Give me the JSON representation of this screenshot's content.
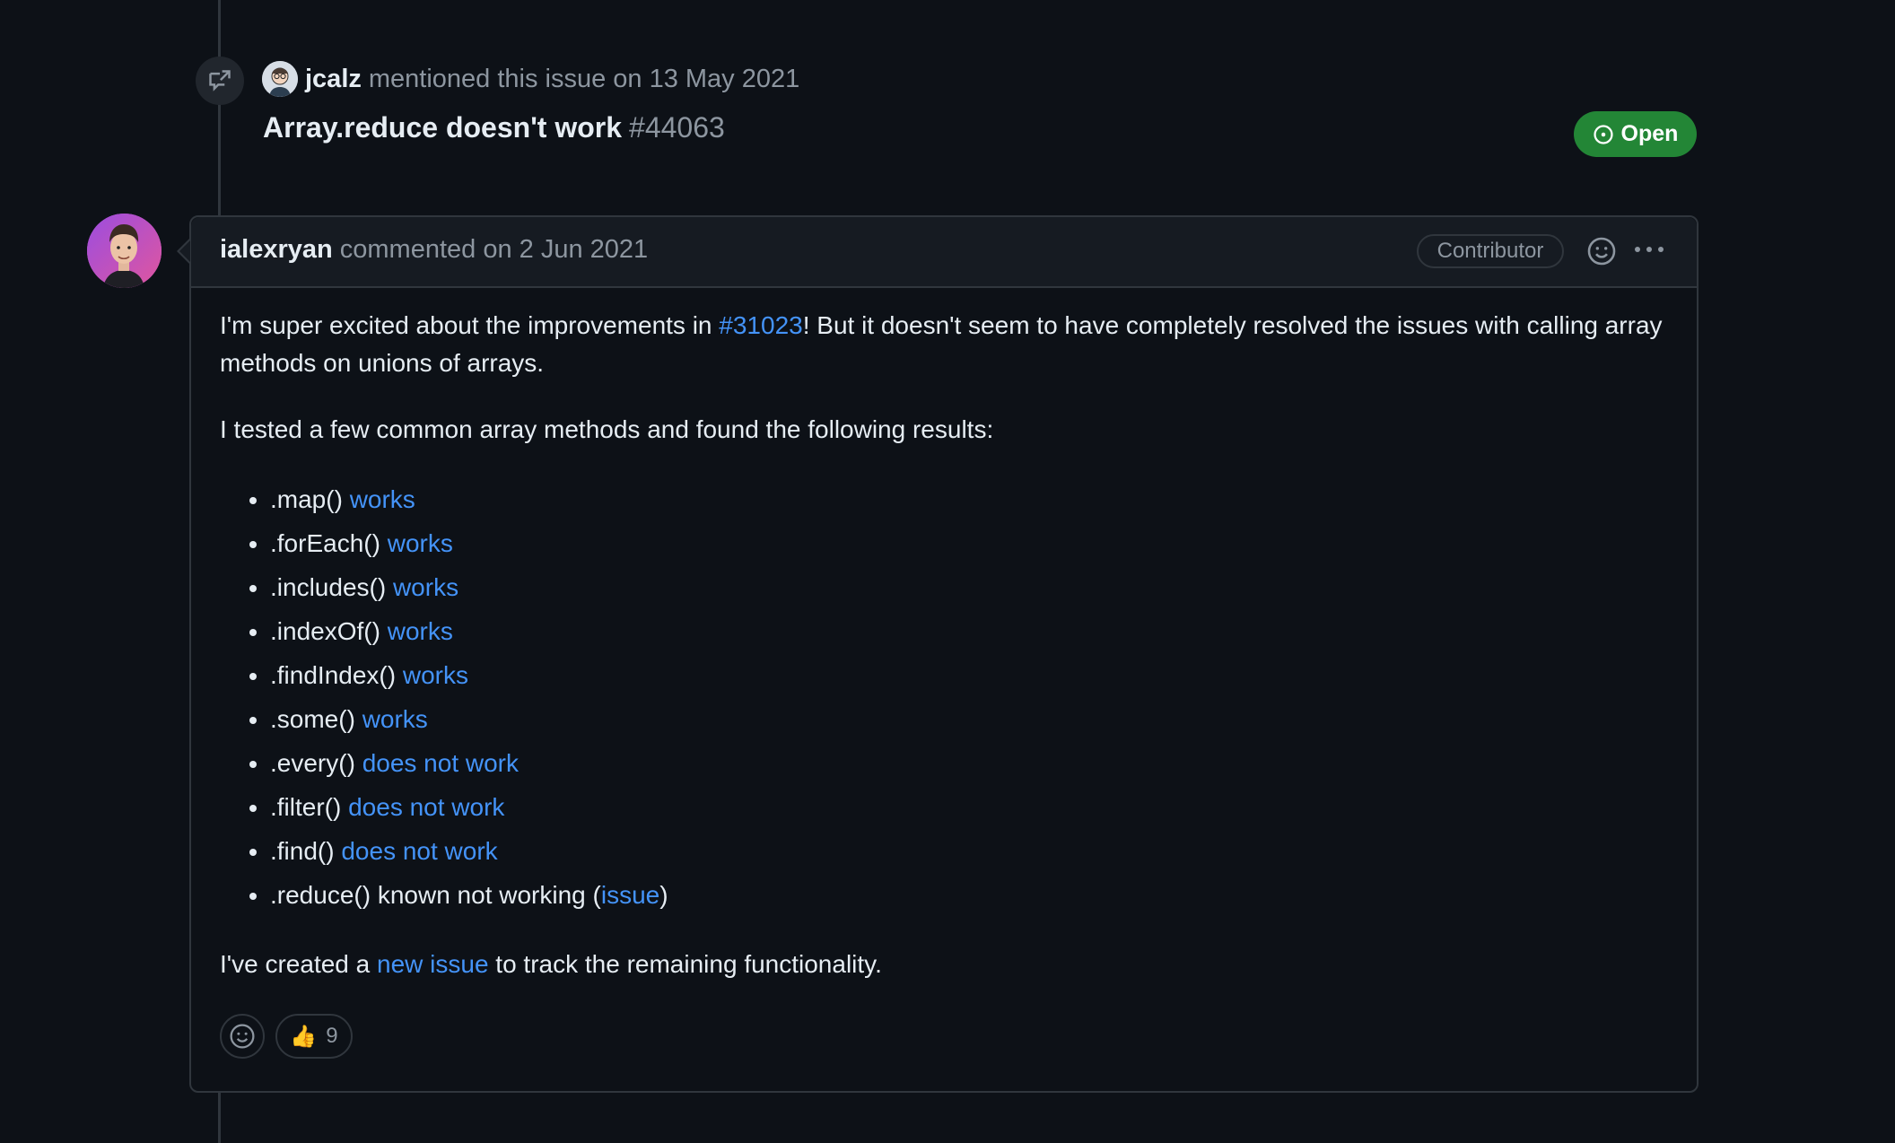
{
  "mention_event": {
    "author": "jcalz",
    "action": "mentioned this issue",
    "date": "on 13 May 2021",
    "issue_title": "Array.reduce doesn't work",
    "issue_number": "#44063",
    "status": "Open"
  },
  "comment": {
    "author": "ialexryan",
    "action": "commented",
    "date": "on 2 Jun 2021",
    "badge": "Contributor",
    "p1_before": "I'm super excited about the improvements in ",
    "p1_link": "#31023",
    "p1_after": "! But it doesn't seem to have completely resolved the issues with calling array methods on unions of arrays.",
    "p2": "I tested a few common array methods and found the following results:",
    "results": [
      {
        "method": ".map()",
        "link": "works"
      },
      {
        "method": ".forEach()",
        "link": "works"
      },
      {
        "method": ".includes()",
        "link": "works"
      },
      {
        "method": ".indexOf()",
        "link": "works"
      },
      {
        "method": ".findIndex()",
        "link": "works"
      },
      {
        "method": ".some()",
        "link": "works"
      },
      {
        "method": ".every()",
        "link": "does not work"
      },
      {
        "method": ".filter()",
        "link": "does not work"
      },
      {
        "method": ".find()",
        "link": "does not work"
      }
    ],
    "last_item": {
      "method": ".reduce()",
      "text": "known not working (",
      "link": "issue",
      "close": ")"
    },
    "p3_before": "I've created a ",
    "p3_link": "new issue",
    "p3_after": " to track the remaining functionality.",
    "reaction": {
      "emoji": "👍",
      "count": "9"
    }
  },
  "icons": [
    "cross-reference-icon",
    "open-issue-icon",
    "smiley-icon",
    "kebab-menu-icon"
  ],
  "colors": {
    "background": "#0d1117",
    "link": "#4493f8",
    "open": "#238636",
    "border": "#30363d"
  }
}
